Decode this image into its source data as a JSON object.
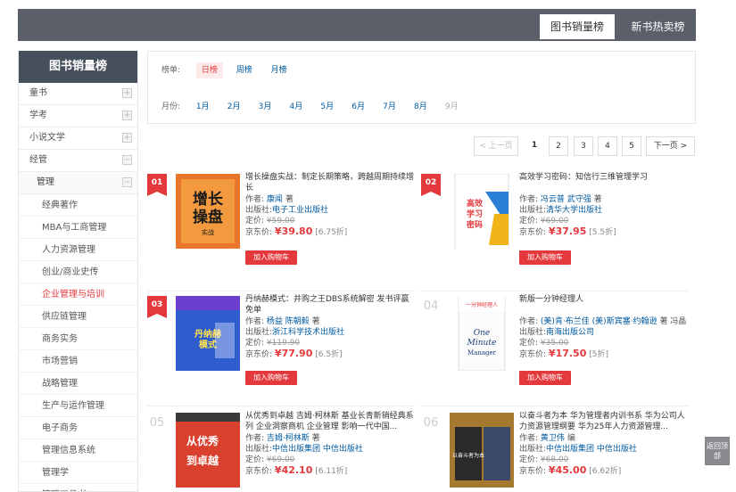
{
  "top_tabs": [
    "图书销量榜",
    "新书热卖榜"
  ],
  "sidebar": {
    "title": "图书销量榜",
    "categories": [
      "童书",
      "学考",
      "小说文学",
      "经管"
    ],
    "subcategory": "管理",
    "leaves": [
      "经典著作",
      "MBA与工商管理",
      "人力资源管理",
      "创业/商业史传",
      "企业管理与培训",
      "供应链管理",
      "商务实务",
      "市场营销",
      "战略管理",
      "生产与运作管理",
      "电子商务",
      "管理信息系统",
      "管理学",
      "管理工具书"
    ],
    "active_leaf": "企业管理与培训"
  },
  "filter": {
    "board_label": "榜单:",
    "boards": [
      "日榜",
      "周榜",
      "月榜"
    ],
    "selected_board": "日榜",
    "month_label": "月份:",
    "months": [
      "1月",
      "2月",
      "3月",
      "4月",
      "5月",
      "6月",
      "7月",
      "8月",
      "9月"
    ]
  },
  "pagination": {
    "prev": "< 上一页",
    "pages": [
      "1",
      "2",
      "3",
      "4",
      "5"
    ],
    "current": "1",
    "next": "下一页 >"
  },
  "labels": {
    "author": "作者:",
    "publisher": "出版社:",
    "list_price": "定价:",
    "jd_price": "京东价:",
    "add_to_cart": "加入购物车",
    "back_to_top": "返回顶部"
  },
  "books": [
    {
      "rank": "01",
      "title": "增长操盘实战：制定长期策略，跨越周期持续增长",
      "author": "康闻",
      "author_suffix": "著",
      "publisher": "电子工业出版社",
      "list_price": "¥59.00",
      "price": "¥39.80",
      "discount": "[6.75折]",
      "cover_text": "增长操盘",
      "cover_sub": "实战"
    },
    {
      "rank": "02",
      "title": "高效学习密码：知信行三维管理学习",
      "author": "冯云普  武守强",
      "author_suffix": "著",
      "publisher": "清华大学出版社",
      "list_price": "¥69.00",
      "price": "¥37.95",
      "discount": "[5.5折]",
      "cover_text": "高效学习密码"
    },
    {
      "rank": "03",
      "title": "丹纳赫模式：并购之王DBS系统解密 发书评赢免单",
      "author": "杨益  陈朝毅",
      "author_suffix": "著",
      "publisher": "浙江科学技术出版社",
      "list_price": "¥119.90",
      "price": "¥77.90",
      "discount": "[6.5折]",
      "cover_text": "丹纳赫模式"
    },
    {
      "rank": "04",
      "title": "新版一分钟经理人",
      "author": "(美)肯·布兰佳  (美)斯宾塞·约翰逊",
      "author_suffix": "著 冯晶 译",
      "publisher": "南海出版公司",
      "list_price": "¥35.00",
      "price": "¥17.50",
      "discount": "[5折]",
      "cover_text": "一分钟经理人"
    },
    {
      "rank": "05",
      "title": "从优秀到卓越 吉姆·柯林斯 基业长青新销经典系列 企业洞察商机 企业管理 影响一代中国...",
      "author": "吉姆·柯林斯",
      "author_suffix": "著",
      "publisher": "中信出版集团  中信出版社",
      "list_price": "¥69.00",
      "price": "¥42.10",
      "discount": "[6.11折]",
      "cover_text": "从优秀 到卓越"
    },
    {
      "rank": "06",
      "title": "以奋斗者为本 华为管理者内训书系 华为公司人力资源管理纲要 华为25年人力资源管理...",
      "author": "黄卫伟",
      "author_suffix": "编",
      "publisher": "中信出版集团  中信出版社",
      "list_price": "¥68.00",
      "price": "¥45.00",
      "discount": "[6.62折]",
      "cover_text": "以奋斗者为本"
    }
  ]
}
